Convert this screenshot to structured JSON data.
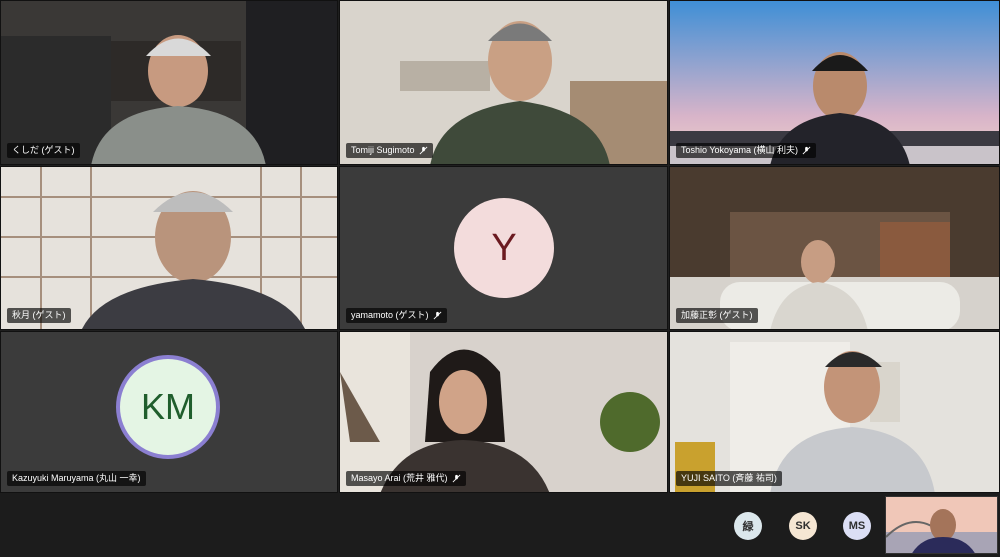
{
  "participants": [
    {
      "name": "くしだ (ゲスト)",
      "muted": false
    },
    {
      "name": "Tomiji Sugimoto",
      "muted": true
    },
    {
      "name": "Toshio Yokoyama (横山 利夫)",
      "muted": true
    },
    {
      "name": "秋月 (ゲスト)",
      "muted": false
    },
    {
      "name": "yamamoto (ゲスト)",
      "muted": true,
      "initials": "Y",
      "avatar_color": "#f3dcdc",
      "text_color": "#6b1a20"
    },
    {
      "name": "加藤正彰 (ゲスト)",
      "muted": false
    },
    {
      "name": "Kazuyuki Maruyama (丸山 一幸)",
      "muted": false,
      "initials": "KM",
      "avatar_color": "#e4f5e4",
      "text_color": "#1f5e2c",
      "ring_color": "#8b7fd1"
    },
    {
      "name": "Masayo Arai (荒井 雅代)",
      "muted": true
    },
    {
      "name": "YUJI SAITO (斉藤 祐司)",
      "muted": false
    }
  ],
  "overflow_participants": [
    {
      "initials": "緑",
      "color": "#dbe7ec"
    },
    {
      "initials": "SK",
      "color": "#f5e6d3"
    },
    {
      "initials": "MS",
      "color": "#dcdff5"
    }
  ],
  "colors": {
    "background": "#1f1f1f",
    "tile_dark": "#3b3b3b"
  }
}
